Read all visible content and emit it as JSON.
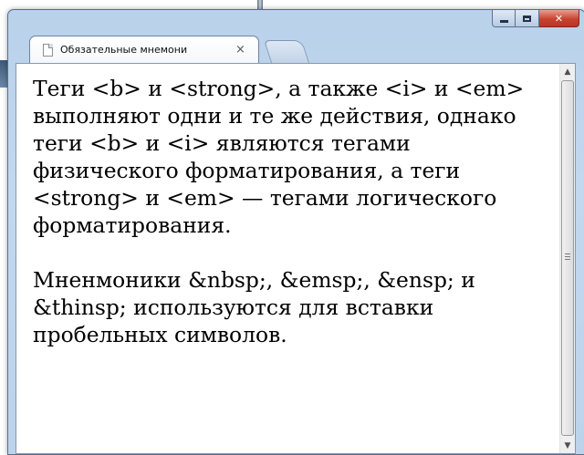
{
  "window": {
    "tab_title": "Обязательные мнемони",
    "tab_close_glyph": "×",
    "caption": {
      "minimize_icon": "minimize-icon",
      "maximize_icon": "maximize-icon",
      "close_glyph": "✕"
    }
  },
  "content": {
    "paragraphs": [
      "Теги <b> и <strong>, а также <i> и <em> выполняют одни и те же действия, однако теги <b> и <i> являются тегами физического форматирования, а теги <strong> и <em> — тегами логического форматирования.",
      "Мненмоники &nbsp;, &emsp;, &ensp; и &thinsp; используются для вставки пробельных символов."
    ]
  },
  "scrollbar": {
    "up_glyph": "▲",
    "down_glyph": "▼"
  },
  "colors": {
    "window_frame": "#bcd3eb",
    "close_button": "#c8432f",
    "page_background": "#ffffff",
    "text": "#000000"
  }
}
